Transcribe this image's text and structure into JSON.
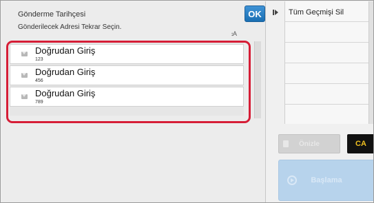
{
  "dialog": {
    "title": "Gönderme Tarihçesi",
    "subtitle": "Gönderilecek Adresi Tekrar Seçin.",
    "ok_label": "OK",
    "sort_label": "A"
  },
  "history": [
    {
      "name": "Doğrudan Giriş",
      "number": "123",
      "icon": "mail-icon"
    },
    {
      "name": "Doğrudan Giriş",
      "number": "456",
      "icon": "mail-icon"
    },
    {
      "name": "Doğrudan Giriş",
      "number": "789",
      "icon": "mail-icon"
    }
  ],
  "right_panel": {
    "menu_items": [
      "Tüm Geçmişi Sil",
      "",
      "",
      "",
      "",
      ""
    ],
    "clear_label": "Önizle",
    "ca_label": "CA",
    "start_label": "Başlama"
  },
  "colors": {
    "highlight": "#d61d36",
    "ok_button": "#1a6fb3",
    "start_button": "#b7d3ec"
  }
}
